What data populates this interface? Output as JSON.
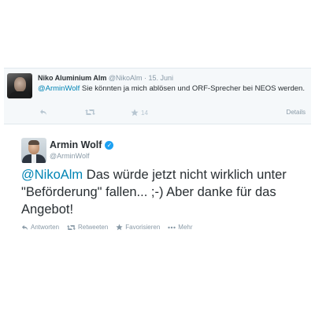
{
  "reply_to": {
    "name": "Niko Aluminium Alm",
    "handle": "@NikoAlm",
    "separator": "·",
    "date": "15. Juni",
    "mention": "@ArminWolf",
    "text": " Sie könnten ja mich ablösen und ORF-Sprecher bei NEOS werden.",
    "favorites_count": "14",
    "details_label": "Details",
    "icons": {
      "reply": "reply-icon",
      "retweet": "retweet-icon",
      "favorite": "star-icon"
    }
  },
  "tweet": {
    "name": "Armin Wolf",
    "handle": "@ArminWolf",
    "mention": "@NikoAlm",
    "text": " Das würde jetzt nicht wirklich unter \"Beförderung\" fallen... ;-) Aber danke für das Angebot!",
    "actions": {
      "reply": "Antworten",
      "retweet": "Retweeten",
      "favorite": "Favorisieren",
      "more": "Mehr"
    },
    "icons": {
      "verified": "verified-badge-icon",
      "more": "more-dots-icon"
    }
  },
  "colors": {
    "link": "#0084b4",
    "verified": "#1da1f2",
    "muted": "#8899a6",
    "parent_bg": "#f5f8fa"
  }
}
